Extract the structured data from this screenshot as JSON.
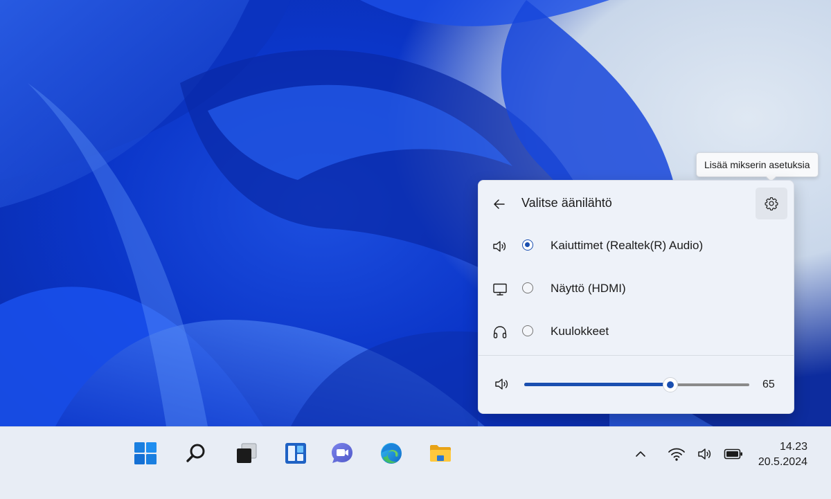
{
  "flyout": {
    "title": "Valitse äänilähtö",
    "back_icon": "arrow-left-icon",
    "settings_icon": "gear-icon",
    "settings_tooltip": "Lisää mikserin asetuksia",
    "devices": [
      {
        "icon": "speaker-icon",
        "label": "Kaiuttimet (Realtek(R) Audio)",
        "selected": true
      },
      {
        "icon": "monitor-icon",
        "label": "Näyttö (HDMI)",
        "selected": false
      },
      {
        "icon": "headphones-icon",
        "label": "Kuulokkeet",
        "selected": false
      }
    ],
    "volume": {
      "icon": "speaker-icon",
      "value": "65",
      "level": 65
    },
    "accent_color": "#1a4fb0"
  },
  "taskbar": {
    "apps": [
      "windows-start-icon",
      "search-icon",
      "task-view-icon",
      "widgets-icon",
      "teams-chat-icon",
      "edge-browser-icon",
      "file-explorer-icon"
    ],
    "tray": [
      "chevron-up-icon",
      "wifi-icon",
      "speaker-icon",
      "battery-icon"
    ],
    "time": "14.23",
    "date": "20.5.2024"
  }
}
